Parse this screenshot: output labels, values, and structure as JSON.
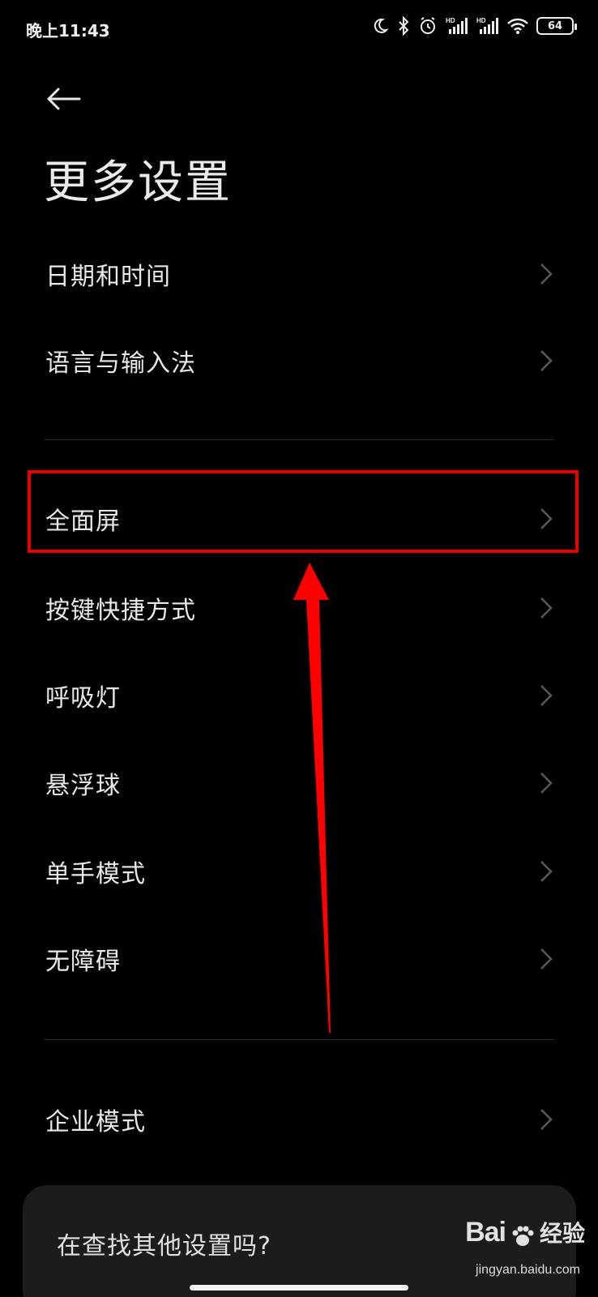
{
  "status_bar": {
    "time": "晚上11:43",
    "battery": "64"
  },
  "header": {
    "back_icon": "arrow-left-icon",
    "title": "更多设置"
  },
  "list_group_1": [
    {
      "label": "日期和时间"
    },
    {
      "label": "语言与输入法"
    }
  ],
  "list_group_2": [
    {
      "label": "全面屏"
    },
    {
      "label": "按键快捷方式"
    },
    {
      "label": "呼吸灯"
    },
    {
      "label": "悬浮球"
    },
    {
      "label": "单手模式"
    },
    {
      "label": "无障碍"
    }
  ],
  "list_group_3": [
    {
      "label": "企业模式"
    }
  ],
  "bottom_card": {
    "text": "在查找其他设置吗?"
  },
  "watermark": {
    "brand": "Bai",
    "brand_suffix": "经验",
    "url": "jingyan.baidu.com"
  },
  "annotation_colors": {
    "highlight": "#e60000",
    "arrow": "#ff0000"
  }
}
